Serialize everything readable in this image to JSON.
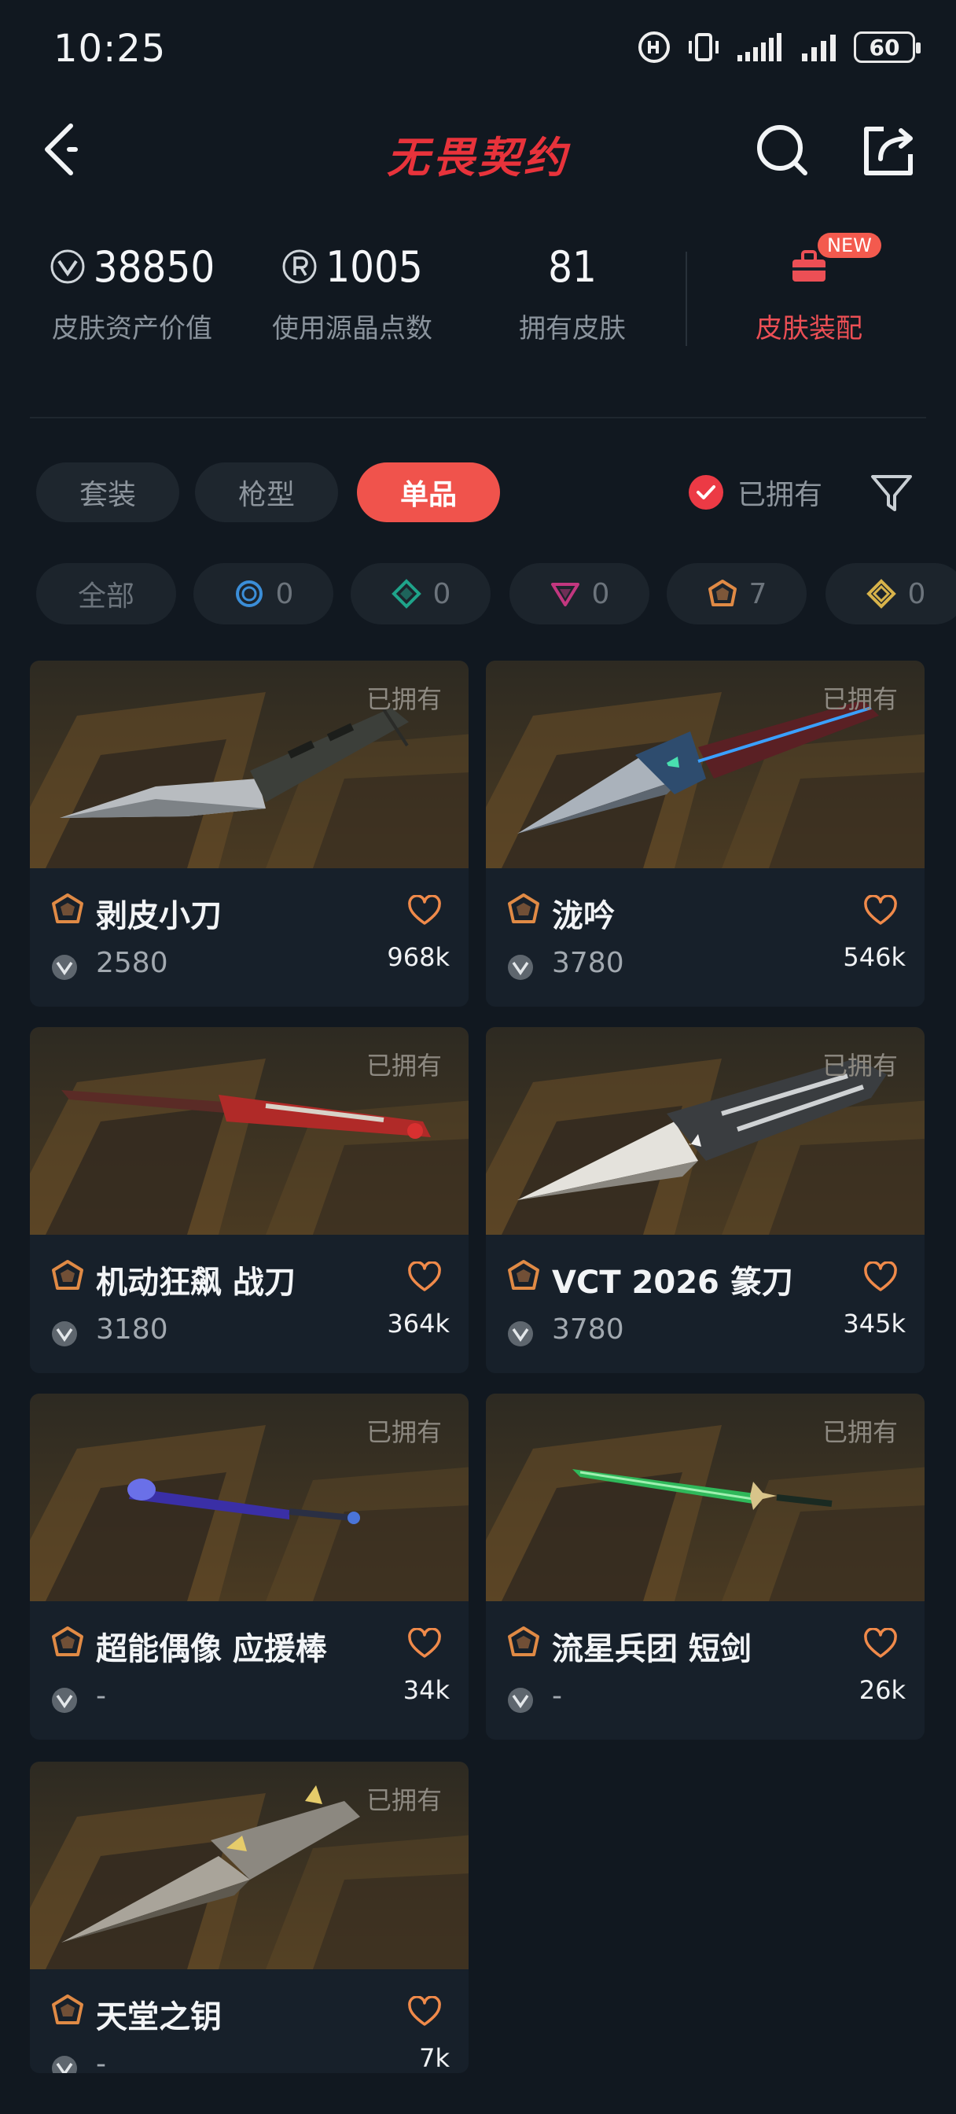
{
  "status": {
    "time": "10:25",
    "battery": "60"
  },
  "header": {
    "title": "无畏契约"
  },
  "stats": [
    {
      "value": "38850",
      "label": "皮肤资产价值",
      "icon": "vp-currency-icon"
    },
    {
      "value": "1005",
      "label": "使用源晶点数",
      "icon": "radianite-icon"
    },
    {
      "value": "81",
      "label": "拥有皮肤"
    }
  ],
  "equip": {
    "label": "皮肤装配",
    "badge": "NEW"
  },
  "tabs": [
    "套装",
    "枪型",
    "单品"
  ],
  "active_tab": "单品",
  "owned_filter": {
    "label": "已拥有",
    "checked": true
  },
  "tiers": [
    {
      "label": "全部"
    },
    {
      "count": "0",
      "icon": "select-tier-icon",
      "color": "#3b8ed8"
    },
    {
      "count": "0",
      "icon": "deluxe-tier-icon",
      "color": "#1fa38a"
    },
    {
      "count": "0",
      "icon": "premium-tier-icon",
      "color": "#c2377f"
    },
    {
      "count": "7",
      "icon": "exclusive-tier-icon",
      "color": "#e08a45"
    },
    {
      "count": "0",
      "icon": "ultra-tier-icon",
      "color": "#d8b34a"
    }
  ],
  "items": [
    {
      "name": "剥皮小刀",
      "price": "2580",
      "likes": "968k",
      "owned": "已拥有"
    },
    {
      "name": "泷吟",
      "price": "3780",
      "likes": "546k",
      "owned": "已拥有"
    },
    {
      "name": "机动狂飙 战刀",
      "price": "3180",
      "likes": "364k",
      "owned": "已拥有"
    },
    {
      "name": "VCT 2026 篆刀",
      "price": "3780",
      "likes": "345k",
      "owned": "已拥有"
    },
    {
      "name": "超能偶像 应援棒",
      "price": "-",
      "likes": "34k",
      "owned": "已拥有"
    },
    {
      "name": "流星兵团 短剑",
      "price": "-",
      "likes": "26k",
      "owned": "已拥有"
    },
    {
      "name": "天堂之钥",
      "price": "-",
      "likes": "7k",
      "owned": "已拥有"
    }
  ],
  "colors": {
    "accent": "#f0534c",
    "tier_exclusive": "#e08a45",
    "background": "#111820"
  }
}
